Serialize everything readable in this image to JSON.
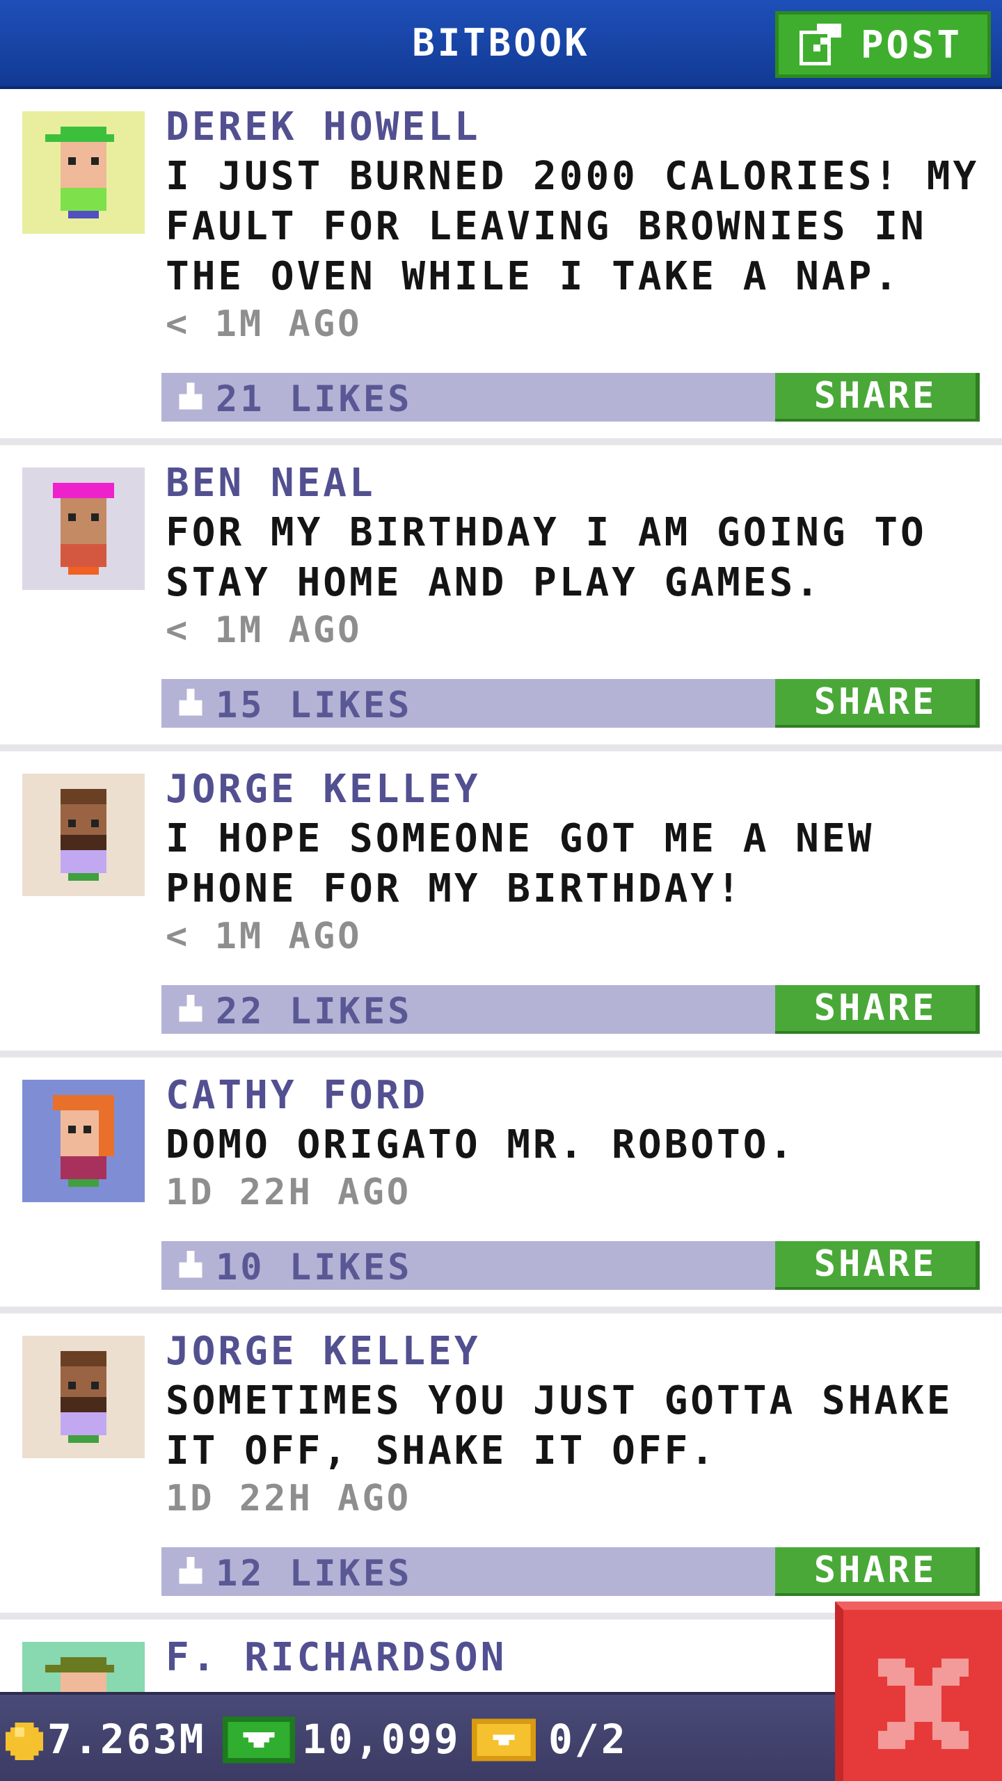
{
  "header": {
    "title": "BITBOOK",
    "post_label": "POST"
  },
  "posts": [
    {
      "author": "DEREK HOWELL",
      "message": "I JUST BURNED 2000 CALORIES! MY FAULT FOR LEAVING BROWNIES IN THE OVEN WHILE I TAKE A NAP.",
      "time": "< 1M AGO",
      "likes": "21 LIKES",
      "share_label": "SHARE",
      "avatar_bg": "#e8ee9e",
      "hair_color": "#3cc03c",
      "shirt_color": "#7ee04a",
      "skin_color": "#f0b99a"
    },
    {
      "author": "BEN NEAL",
      "message": "FOR MY BIRTHDAY I AM GOING TO STAY HOME AND PLAY GAMES.",
      "time": "< 1M AGO",
      "likes": "15 LIKES",
      "share_label": "SHARE",
      "avatar_bg": "#dcd8e6",
      "hair_color": "#ee22cc",
      "shirt_color": "#d45840",
      "skin_color": "#c48a64"
    },
    {
      "author": "JORGE KELLEY",
      "message": "I HOPE SOMEONE GOT ME A NEW PHONE FOR MY BIRTHDAY!",
      "time": "< 1M AGO",
      "likes": "22 LIKES",
      "share_label": "SHARE",
      "avatar_bg": "#ecdfd0",
      "hair_color": "#6a4024",
      "shirt_color": "#c2a8f0",
      "skin_color": "#9a6444"
    },
    {
      "author": "CATHY FORD",
      "message": "DOMO ORIGATO MR. ROBOTO.",
      "time": "1D 22H AGO",
      "likes": "10 LIKES",
      "share_label": "SHARE",
      "avatar_bg": "#7f8ed4",
      "hair_color": "#e8702a",
      "shirt_color": "#a8305c",
      "skin_color": "#f0b99a"
    },
    {
      "author": "JORGE KELLEY",
      "message": "SOMETIMES YOU JUST GOTTA SHAKE IT OFF, SHAKE IT OFF.",
      "time": "1D 22H AGO",
      "likes": "12 LIKES",
      "share_label": "SHARE",
      "avatar_bg": "#ecdfd0",
      "hair_color": "#6a4024",
      "shirt_color": "#c2a8f0",
      "skin_color": "#9a6444"
    },
    {
      "author": "F. RICHARDSON",
      "avatar_bg": "#88d8b0",
      "hair_color": "#6a7a20",
      "skin_color": "#f0b99a"
    }
  ],
  "status": {
    "coins": "7.263M",
    "bux": "10,099",
    "tickets": "0/2"
  },
  "colors": {
    "header": "#1a47ae",
    "share_green": "#4aa838",
    "likes_bar": "#b4b3d6",
    "author": "#525090",
    "close_red": "#e63a3a"
  },
  "icons": [
    "edit-icon",
    "like-icon",
    "coin-icon",
    "bux-icon",
    "ticket-icon",
    "close-icon"
  ]
}
